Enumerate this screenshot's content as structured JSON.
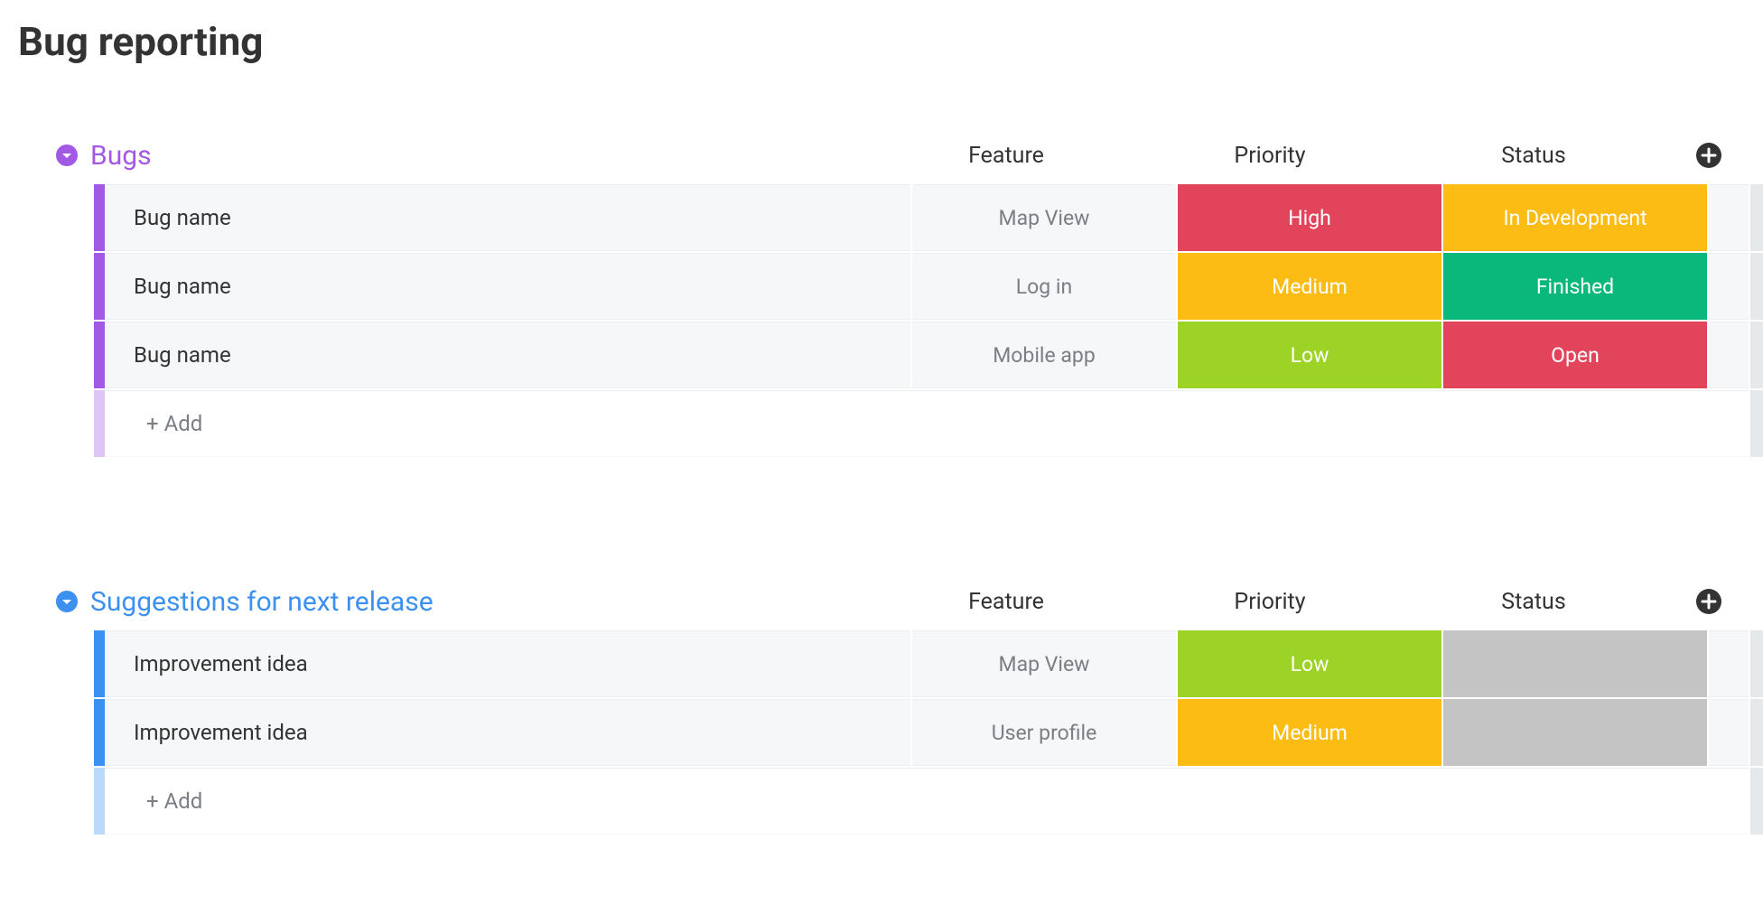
{
  "page_title": "Bug reporting",
  "columns": [
    "Feature",
    "Priority",
    "Status"
  ],
  "groups": [
    {
      "title": "Bugs",
      "accent": "#a259e4",
      "title_color": "#a259e4",
      "add_label": "+ Add",
      "rows": [
        {
          "name": "Bug name",
          "feature": "Map View",
          "priority": {
            "label": "High",
            "bg": "#e2445c"
          },
          "status": {
            "label": "In Development",
            "bg": "#fdbc14"
          }
        },
        {
          "name": "Bug name",
          "feature": "Log in",
          "priority": {
            "label": "Medium",
            "bg": "#fdbc14"
          },
          "status": {
            "label": "Finished",
            "bg": "#0ab87b"
          }
        },
        {
          "name": "Bug name",
          "feature": "Mobile app",
          "priority": {
            "label": "Low",
            "bg": "#9cd326"
          },
          "status": {
            "label": "Open",
            "bg": "#e2445c"
          }
        }
      ]
    },
    {
      "title": "Suggestions for next release",
      "accent": "#3c91f0",
      "title_color": "#3c91f0",
      "add_label": "+ Add",
      "rows": [
        {
          "name": "Improvement idea",
          "feature": "Map View",
          "priority": {
            "label": "Low",
            "bg": "#9cd326"
          },
          "status": {
            "label": "",
            "bg": "#c4c4c4"
          }
        },
        {
          "name": "Improvement idea",
          "feature": "User profile",
          "priority": {
            "label": "Medium",
            "bg": "#fdbc14"
          },
          "status": {
            "label": "",
            "bg": "#c4c4c4"
          }
        }
      ]
    }
  ]
}
